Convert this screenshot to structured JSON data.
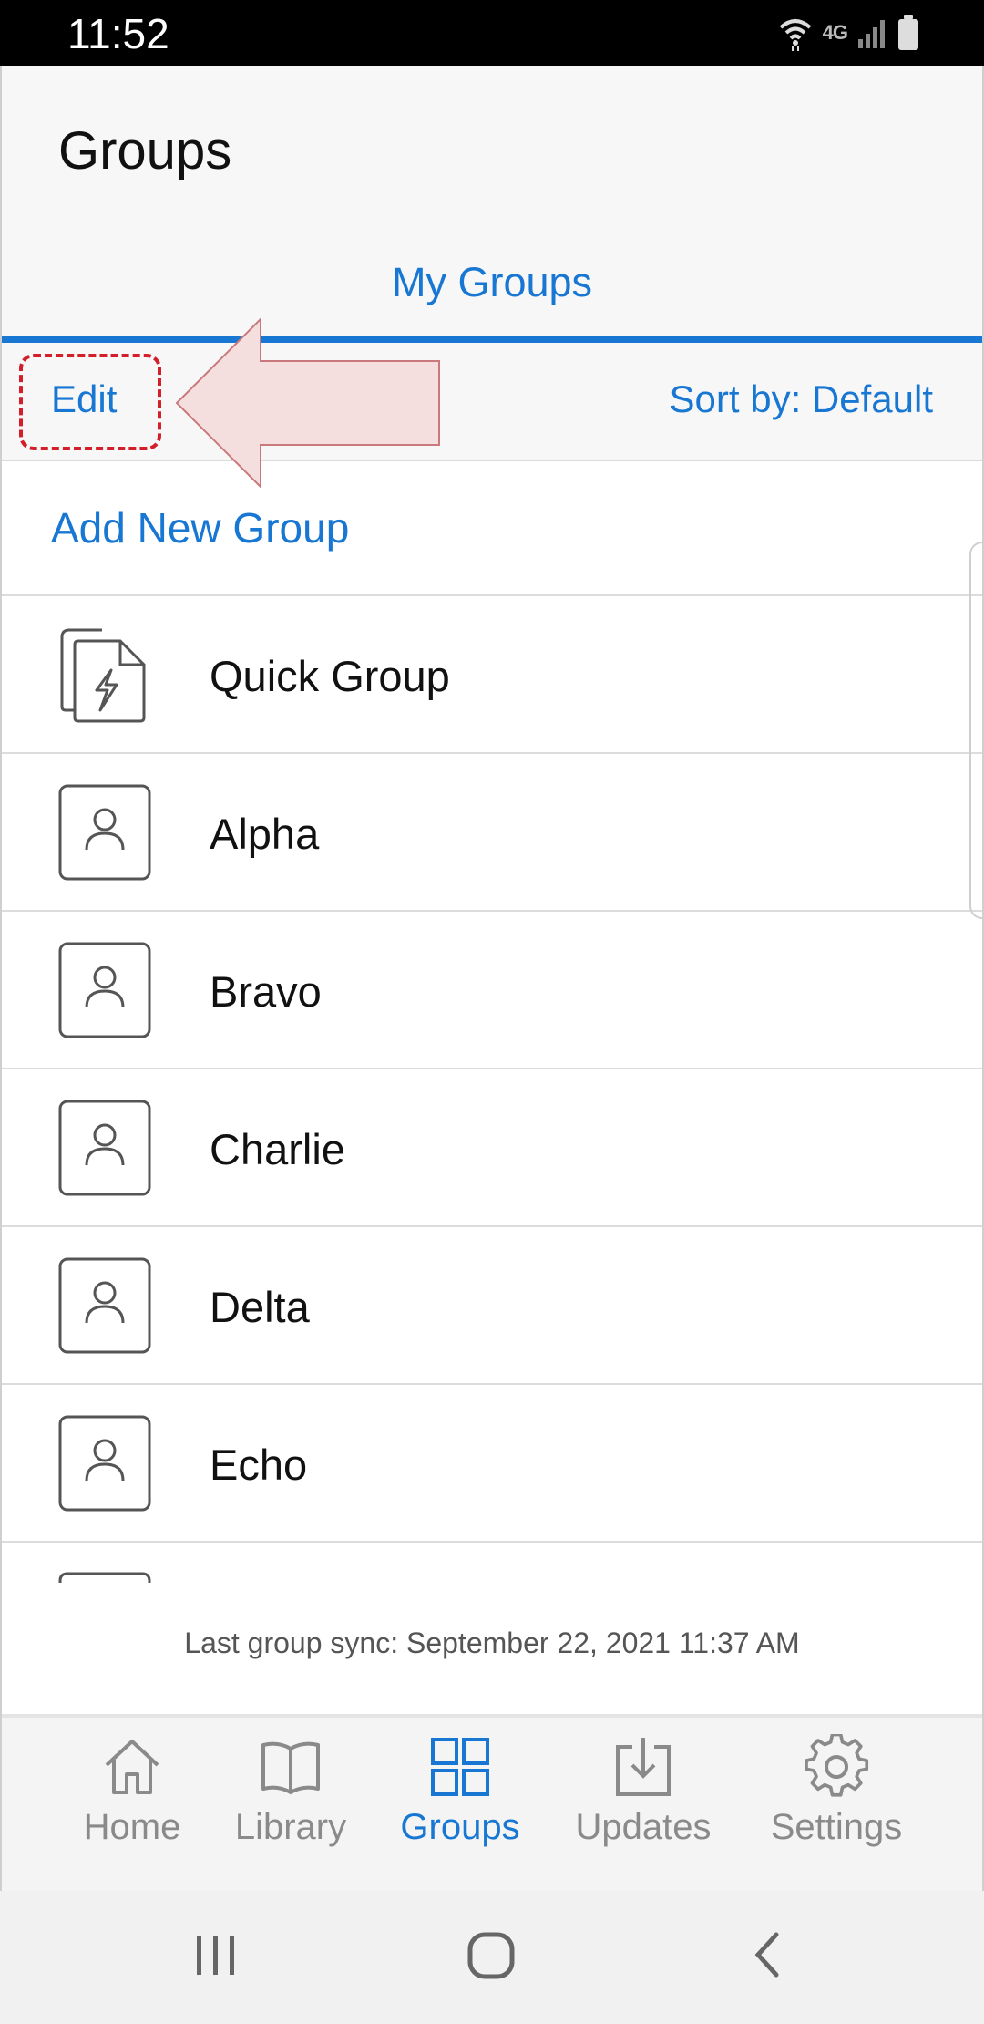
{
  "status_bar": {
    "time": "11:52",
    "network": "4G",
    "icons": [
      "wifi-icon",
      "signal-icon",
      "battery-icon"
    ]
  },
  "header": {
    "title": "Groups"
  },
  "tabs": [
    {
      "label": "My Groups",
      "active": true
    }
  ],
  "toolbar": {
    "edit_label": "Edit",
    "sort_label": "Sort by: Default"
  },
  "list": {
    "add_label": "Add New Group",
    "items": [
      {
        "label": "Quick Group",
        "icon": "quick-group-icon"
      },
      {
        "label": "Alpha",
        "icon": "person-icon"
      },
      {
        "label": "Bravo",
        "icon": "person-icon"
      },
      {
        "label": "Charlie",
        "icon": "person-icon"
      },
      {
        "label": "Delta",
        "icon": "person-icon"
      },
      {
        "label": "Echo",
        "icon": "person-icon"
      }
    ]
  },
  "sync": {
    "text": "Last group sync: September 22, 2021 11:37 AM"
  },
  "bottom_nav": [
    {
      "label": "Home",
      "icon": "home-icon",
      "active": false
    },
    {
      "label": "Library",
      "icon": "book-icon",
      "active": false
    },
    {
      "label": "Groups",
      "icon": "grid-icon",
      "active": true
    },
    {
      "label": "Updates",
      "icon": "download-icon",
      "active": false
    },
    {
      "label": "Settings",
      "icon": "gear-icon",
      "active": false
    }
  ],
  "colors": {
    "accent": "#1877d2",
    "highlight": "#d21f2a",
    "callout_fill": "#f5dede"
  }
}
